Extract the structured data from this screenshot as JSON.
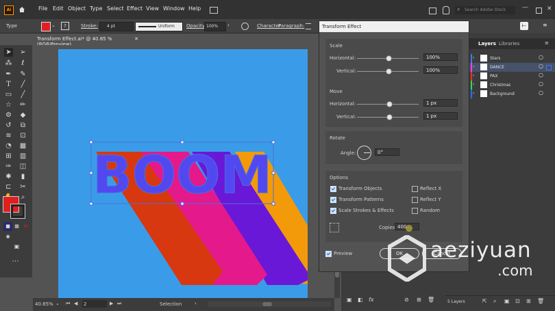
{
  "app": {
    "logo": "Ai"
  },
  "menu": [
    "File",
    "Edit",
    "Object",
    "Type",
    "Select",
    "Effect",
    "View",
    "Window",
    "Help"
  ],
  "search": {
    "placeholder": "Search Adobe Stock"
  },
  "control": {
    "type_label": "Type",
    "stroke_label": "Stroke:",
    "stroke_value": "4 pt",
    "profile_value": "Uniform",
    "opacity_label": "Opacity:",
    "opacity_value": "100%",
    "character_label": "Character",
    "paragraph_label": "Paragraph:"
  },
  "document": {
    "tab_title": "Transform Effect.ai* @ 40.85 % (RGB/Preview)"
  },
  "artwork": {
    "text": "BOOM"
  },
  "status": {
    "zoom": "40.85%",
    "artboard": "2",
    "tool": "Selection"
  },
  "dialog": {
    "title": "Transform Effect",
    "scale": {
      "label": "Scale",
      "horizontal_label": "Horizontal:",
      "horizontal_value": "100%",
      "vertical_label": "Vertical:",
      "vertical_value": "100%"
    },
    "move": {
      "label": "Move",
      "horizontal_label": "Horizontal:",
      "horizontal_value": "1 px",
      "vertical_label": "Vertical:",
      "vertical_value": "1 px"
    },
    "rotate": {
      "label": "Rotate",
      "angle_label": "Angle:",
      "angle_value": "0°"
    },
    "options": {
      "label": "Options",
      "transform_objects": "Transform Objects",
      "transform_patterns": "Transform Patterns",
      "scale_strokes": "Scale Strokes & Effects",
      "reflect_x": "Reflect X",
      "reflect_y": "Reflect Y",
      "random": "Random"
    },
    "copies_label": "Copies",
    "copies_value": "400",
    "preview_label": "Preview",
    "ok_label": "OK",
    "cancel_label": "Cancel"
  },
  "layers": {
    "tab_layers": "Layers",
    "tab_libraries": "Libraries",
    "items": [
      {
        "name": "Stars",
        "color": "#3b7cf0"
      },
      {
        "name": "DANCE",
        "color": "#ff3df2"
      },
      {
        "name": "PAX",
        "color": "#ff2d2d"
      },
      {
        "name": "Christmas",
        "color": "#2de04a"
      },
      {
        "name": "Background",
        "color": "#2d6bff"
      }
    ],
    "count": "5 Layers"
  },
  "watermark": {
    "line1": "aeziyuan",
    "line2": ".com"
  },
  "colors": {
    "artboard": "#3a9ce8",
    "fill_swatch": "#e02020",
    "boom_text": "#5248f0",
    "selection": "#4a6ee0"
  }
}
